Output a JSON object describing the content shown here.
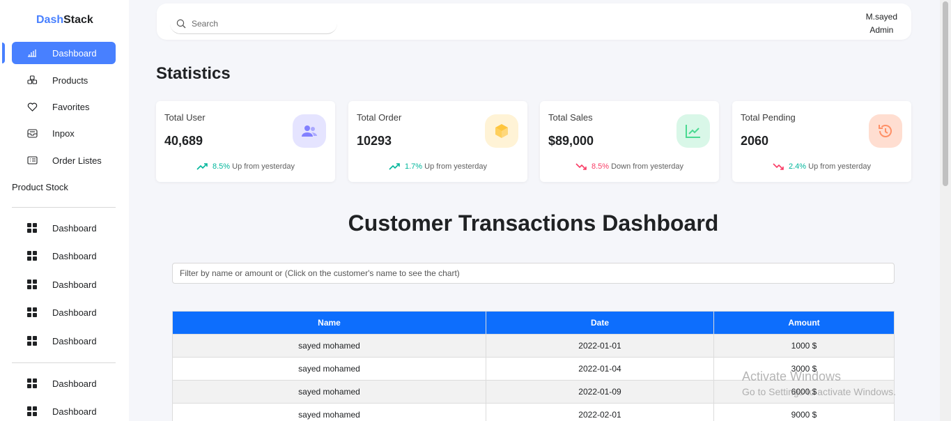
{
  "sidebar": {
    "logo_prefix": "Dash",
    "logo_suffix": "Stack",
    "items": [
      {
        "label": "Dashboard",
        "icon": "bar-chart-icon",
        "active": true
      },
      {
        "label": "Products",
        "icon": "cubes-icon"
      },
      {
        "label": "Favorites",
        "icon": "heart-icon"
      },
      {
        "label": "Inpox",
        "icon": "inbox-icon"
      },
      {
        "label": "Order Listes",
        "icon": "list-icon"
      },
      {
        "label": "Product Stock",
        "icon": ""
      }
    ],
    "group2": [
      {
        "label": "Dashboard",
        "icon": "grid-icon"
      },
      {
        "label": "Dashboard",
        "icon": "grid-icon"
      },
      {
        "label": "Dashboard",
        "icon": "grid-icon"
      },
      {
        "label": "Dashboard",
        "icon": "grid-icon"
      },
      {
        "label": "Dashboard",
        "icon": "grid-icon"
      }
    ],
    "group3": [
      {
        "label": "Dashboard",
        "icon": "grid-icon"
      },
      {
        "label": "Dashboard",
        "icon": "grid-icon"
      }
    ]
  },
  "topbar": {
    "search_placeholder": "Search",
    "user_name": "M.sayed",
    "user_role": "Admin"
  },
  "statistics": {
    "title": "Statistics",
    "cards": [
      {
        "title": "Total User",
        "value": "40,689",
        "trend_value": "8.5%",
        "trend_text": "Up from yesterday",
        "direction": "up",
        "icon": "users-icon",
        "icon_bg": "#e5e4ff",
        "icon_color": "#8280ff"
      },
      {
        "title": "Total Order",
        "value": "10293",
        "trend_value": "1.7%",
        "trend_text": "Up from yesterday",
        "direction": "up",
        "icon": "box-icon",
        "icon_bg": "#fff3d6",
        "icon_color": "#fec53d"
      },
      {
        "title": "Total Sales",
        "value": "$89,000",
        "trend_value": "8.5%",
        "trend_text": "Down from yesterday",
        "direction": "down",
        "icon": "line-chart-icon",
        "icon_bg": "#d9f7e8",
        "icon_color": "#4ad991"
      },
      {
        "title": "Total Pending",
        "value": "2060",
        "trend_value": "2.4%",
        "trend_text": "Up from yesterday",
        "direction": "down",
        "icon": "history-icon",
        "icon_bg": "#ffded1",
        "icon_color": "#ff9066"
      }
    ]
  },
  "transactions": {
    "title": "Customer Transactions Dashboard",
    "filter_placeholder": "Filter by name or amount or (Click on the customer's name to see the chart)",
    "columns": [
      "Name",
      "Date",
      "Amount"
    ],
    "rows": [
      [
        "sayed mohamed",
        "2022-01-01",
        "1000 $"
      ],
      [
        "sayed mohamed",
        "2022-01-04",
        "3000 $"
      ],
      [
        "sayed mohamed",
        "2022-01-09",
        "6000 $"
      ],
      [
        "sayed mohamed",
        "2022-02-01",
        "9000 $"
      ]
    ]
  },
  "watermark": {
    "line1": "Activate Windows",
    "line2": "Go to Settings to activate Windows."
  },
  "colors": {
    "accent": "#4880ff",
    "table_header": "#0d6efd",
    "up": "#00b69b",
    "down": "#f93c65"
  }
}
